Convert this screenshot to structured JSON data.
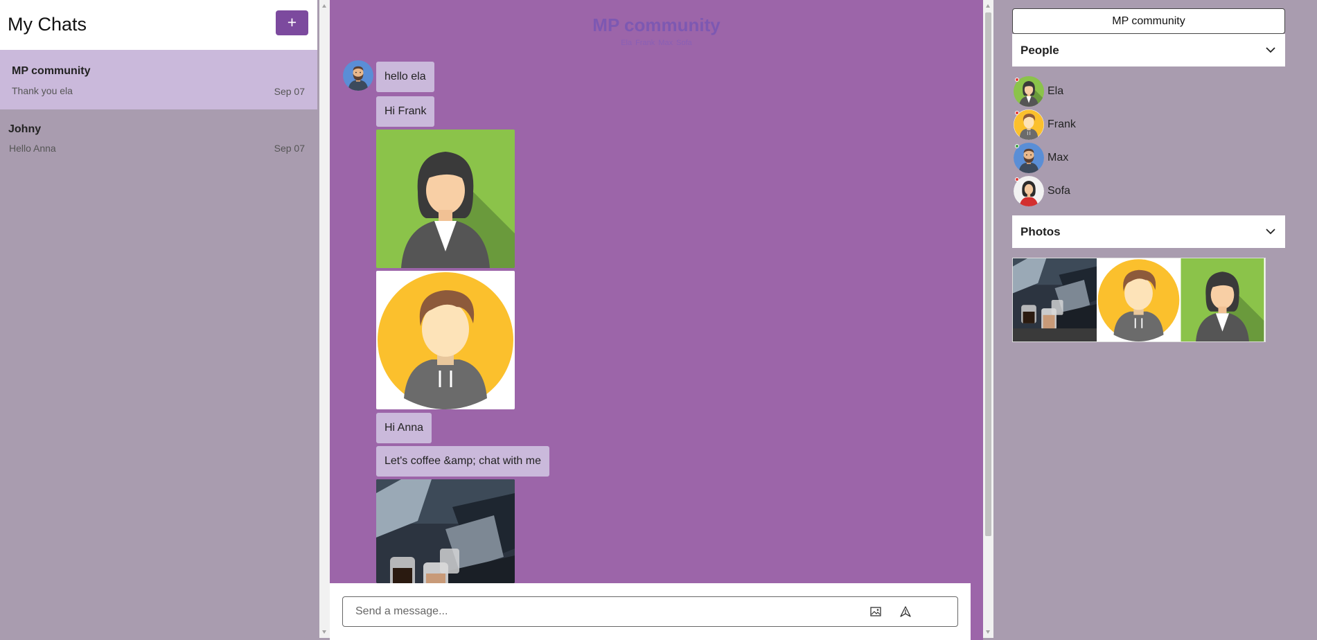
{
  "sidebar": {
    "title": "My Chats",
    "new_chat_label": "+",
    "chats": [
      {
        "name": "MP community",
        "preview": "Thank you ela",
        "date": "Sep 07",
        "active": true
      },
      {
        "name": "Johny",
        "preview": "Hello Anna",
        "date": "Sep 07",
        "active": false
      }
    ]
  },
  "conversation": {
    "title": "MP community",
    "members": "Ela Frank Max Sofa",
    "messages": [
      {
        "type": "text",
        "text": "hello ela"
      },
      {
        "type": "text",
        "text": "Hi Frank"
      },
      {
        "type": "image",
        "icon": "woman-avatar-image"
      },
      {
        "type": "image",
        "icon": "man-avatar-image"
      },
      {
        "type": "text",
        "text": "Hi Anna"
      },
      {
        "type": "text",
        "text": "Let's coffee &amp; chat with me"
      },
      {
        "type": "image",
        "icon": "coffee-laptop-photo"
      }
    ],
    "composer": {
      "placeholder": "Send a message..."
    }
  },
  "details": {
    "group_name": "MP community",
    "people_label": "People",
    "people": [
      {
        "name": "Ela",
        "status_color": "#e53935"
      },
      {
        "name": "Frank",
        "status_color": "#e53935"
      },
      {
        "name": "Max",
        "status_color": "#43a047"
      },
      {
        "name": "Sofa",
        "status_color": "#e53935"
      }
    ],
    "photos_label": "Photos"
  },
  "colors": {
    "accent": "#7c4a9e",
    "chat_background": "#9c65a9",
    "bubble": "#cab9db",
    "panel_background": "#a99caf"
  }
}
